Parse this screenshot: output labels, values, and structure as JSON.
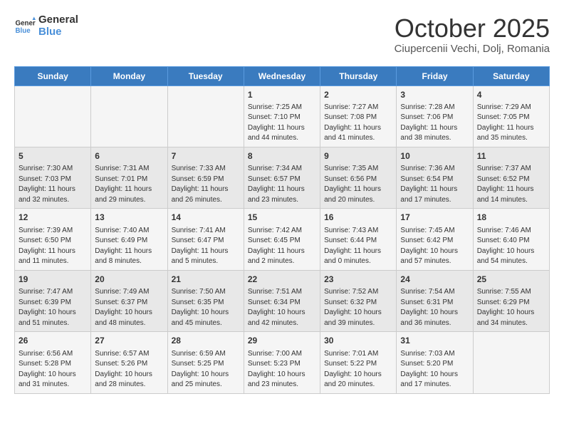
{
  "header": {
    "logo_general": "General",
    "logo_blue": "Blue",
    "month": "October 2025",
    "location": "Ciupercenii Vechi, Dolj, Romania"
  },
  "weekdays": [
    "Sunday",
    "Monday",
    "Tuesday",
    "Wednesday",
    "Thursday",
    "Friday",
    "Saturday"
  ],
  "weeks": [
    [
      {
        "day": "",
        "info": ""
      },
      {
        "day": "",
        "info": ""
      },
      {
        "day": "",
        "info": ""
      },
      {
        "day": "1",
        "info": "Sunrise: 7:25 AM\nSunset: 7:10 PM\nDaylight: 11 hours and 44 minutes."
      },
      {
        "day": "2",
        "info": "Sunrise: 7:27 AM\nSunset: 7:08 PM\nDaylight: 11 hours and 41 minutes."
      },
      {
        "day": "3",
        "info": "Sunrise: 7:28 AM\nSunset: 7:06 PM\nDaylight: 11 hours and 38 minutes."
      },
      {
        "day": "4",
        "info": "Sunrise: 7:29 AM\nSunset: 7:05 PM\nDaylight: 11 hours and 35 minutes."
      }
    ],
    [
      {
        "day": "5",
        "info": "Sunrise: 7:30 AM\nSunset: 7:03 PM\nDaylight: 11 hours and 32 minutes."
      },
      {
        "day": "6",
        "info": "Sunrise: 7:31 AM\nSunset: 7:01 PM\nDaylight: 11 hours and 29 minutes."
      },
      {
        "day": "7",
        "info": "Sunrise: 7:33 AM\nSunset: 6:59 PM\nDaylight: 11 hours and 26 minutes."
      },
      {
        "day": "8",
        "info": "Sunrise: 7:34 AM\nSunset: 6:57 PM\nDaylight: 11 hours and 23 minutes."
      },
      {
        "day": "9",
        "info": "Sunrise: 7:35 AM\nSunset: 6:56 PM\nDaylight: 11 hours and 20 minutes."
      },
      {
        "day": "10",
        "info": "Sunrise: 7:36 AM\nSunset: 6:54 PM\nDaylight: 11 hours and 17 minutes."
      },
      {
        "day": "11",
        "info": "Sunrise: 7:37 AM\nSunset: 6:52 PM\nDaylight: 11 hours and 14 minutes."
      }
    ],
    [
      {
        "day": "12",
        "info": "Sunrise: 7:39 AM\nSunset: 6:50 PM\nDaylight: 11 hours and 11 minutes."
      },
      {
        "day": "13",
        "info": "Sunrise: 7:40 AM\nSunset: 6:49 PM\nDaylight: 11 hours and 8 minutes."
      },
      {
        "day": "14",
        "info": "Sunrise: 7:41 AM\nSunset: 6:47 PM\nDaylight: 11 hours and 5 minutes."
      },
      {
        "day": "15",
        "info": "Sunrise: 7:42 AM\nSunset: 6:45 PM\nDaylight: 11 hours and 2 minutes."
      },
      {
        "day": "16",
        "info": "Sunrise: 7:43 AM\nSunset: 6:44 PM\nDaylight: 11 hours and 0 minutes."
      },
      {
        "day": "17",
        "info": "Sunrise: 7:45 AM\nSunset: 6:42 PM\nDaylight: 10 hours and 57 minutes."
      },
      {
        "day": "18",
        "info": "Sunrise: 7:46 AM\nSunset: 6:40 PM\nDaylight: 10 hours and 54 minutes."
      }
    ],
    [
      {
        "day": "19",
        "info": "Sunrise: 7:47 AM\nSunset: 6:39 PM\nDaylight: 10 hours and 51 minutes."
      },
      {
        "day": "20",
        "info": "Sunrise: 7:49 AM\nSunset: 6:37 PM\nDaylight: 10 hours and 48 minutes."
      },
      {
        "day": "21",
        "info": "Sunrise: 7:50 AM\nSunset: 6:35 PM\nDaylight: 10 hours and 45 minutes."
      },
      {
        "day": "22",
        "info": "Sunrise: 7:51 AM\nSunset: 6:34 PM\nDaylight: 10 hours and 42 minutes."
      },
      {
        "day": "23",
        "info": "Sunrise: 7:52 AM\nSunset: 6:32 PM\nDaylight: 10 hours and 39 minutes."
      },
      {
        "day": "24",
        "info": "Sunrise: 7:54 AM\nSunset: 6:31 PM\nDaylight: 10 hours and 36 minutes."
      },
      {
        "day": "25",
        "info": "Sunrise: 7:55 AM\nSunset: 6:29 PM\nDaylight: 10 hours and 34 minutes."
      }
    ],
    [
      {
        "day": "26",
        "info": "Sunrise: 6:56 AM\nSunset: 5:28 PM\nDaylight: 10 hours and 31 minutes."
      },
      {
        "day": "27",
        "info": "Sunrise: 6:57 AM\nSunset: 5:26 PM\nDaylight: 10 hours and 28 minutes."
      },
      {
        "day": "28",
        "info": "Sunrise: 6:59 AM\nSunset: 5:25 PM\nDaylight: 10 hours and 25 minutes."
      },
      {
        "day": "29",
        "info": "Sunrise: 7:00 AM\nSunset: 5:23 PM\nDaylight: 10 hours and 23 minutes."
      },
      {
        "day": "30",
        "info": "Sunrise: 7:01 AM\nSunset: 5:22 PM\nDaylight: 10 hours and 20 minutes."
      },
      {
        "day": "31",
        "info": "Sunrise: 7:03 AM\nSunset: 5:20 PM\nDaylight: 10 hours and 17 minutes."
      },
      {
        "day": "",
        "info": ""
      }
    ]
  ]
}
